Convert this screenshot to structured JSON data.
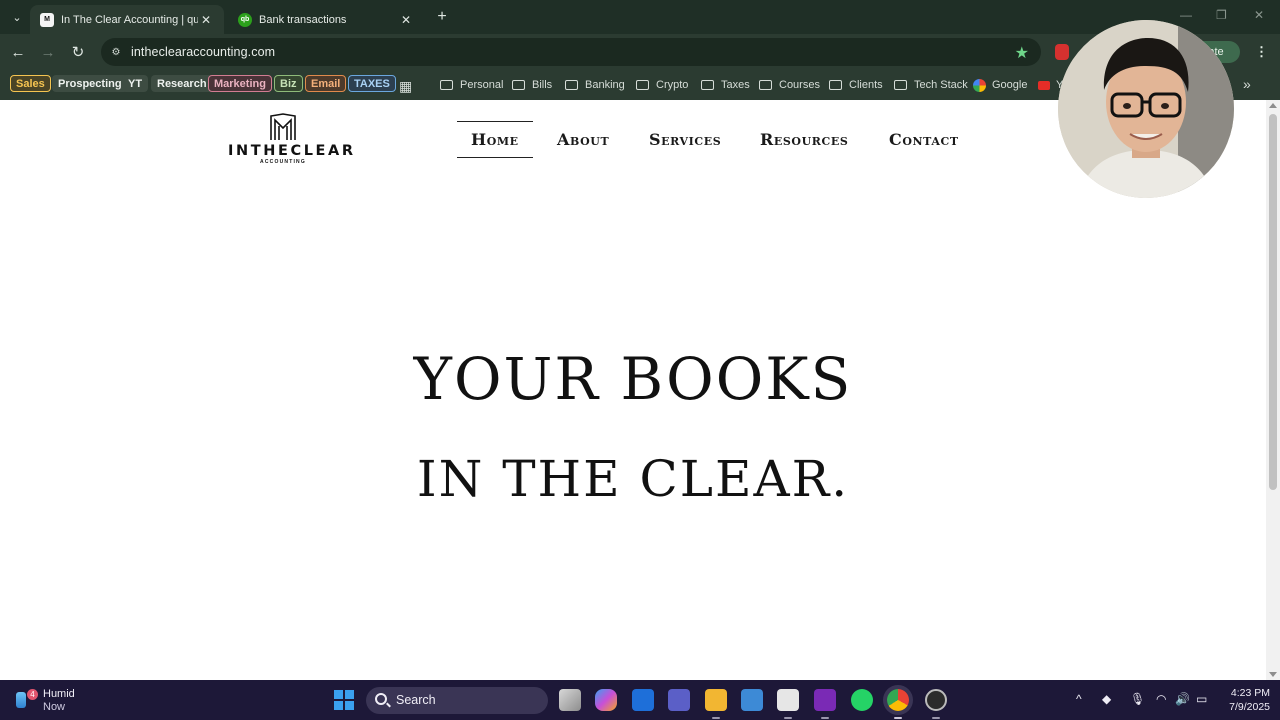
{
  "browser": {
    "tabs": [
      {
        "title": "In The Clear Accounting | quickb",
        "active": true
      },
      {
        "title": "Bank transactions",
        "active": false
      }
    ],
    "url": "intheclearaccounting.com",
    "update_label": "update"
  },
  "bookmarks": {
    "chips": [
      {
        "label": "Sales",
        "color": "#f5c451"
      },
      {
        "label": "Prospecting",
        "color": "#dfe6e1"
      },
      {
        "label": "YT",
        "color": "#dfe6e1"
      },
      {
        "label": "Research",
        "color": "#dfe6e1"
      },
      {
        "label": "Marketing",
        "color": "#e8a0b0"
      },
      {
        "label": "Biz",
        "color": "#b9d9a6"
      },
      {
        "label": "Email",
        "color": "#f0a66a"
      },
      {
        "label": "TAXES",
        "color": "#8fc3f0"
      }
    ],
    "folders": [
      "Personal",
      "Bills",
      "Banking",
      "Crypto",
      "Taxes",
      "Courses",
      "Clients",
      "Tech Stack"
    ],
    "links": [
      "Google",
      "Y"
    ]
  },
  "site": {
    "logo": {
      "word": "INTHECLEAR",
      "sub": "ACCOUNTING"
    },
    "nav": [
      "Home",
      "About",
      "Services",
      "Resources",
      "Contact"
    ],
    "hero": {
      "line1": "YOUR BOOKS",
      "line2": "IN THE CLEAR."
    }
  },
  "taskbar": {
    "weather": {
      "title": "Humid",
      "subtitle": "Now",
      "badge": "4"
    },
    "search_label": "Search",
    "time": "4:23 PM",
    "date": "7/9/2025"
  }
}
